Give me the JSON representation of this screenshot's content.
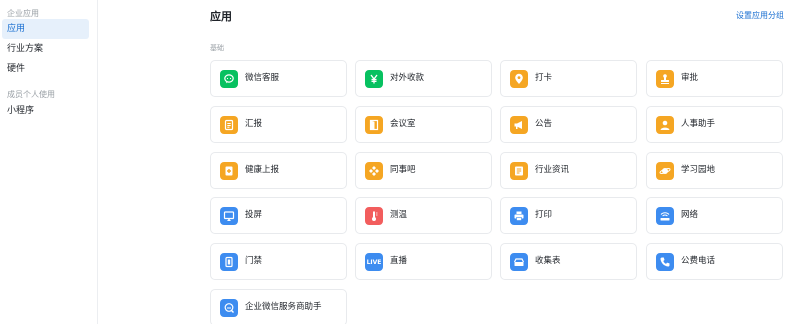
{
  "sidebar": {
    "group1": "企业应用",
    "group2": "成员个人使用",
    "items": [
      {
        "label": "应用",
        "active": true
      },
      {
        "label": "行业方案"
      },
      {
        "label": "硬件"
      },
      {
        "label": "小程序"
      }
    ]
  },
  "header": {
    "title": "应用",
    "settings_link": "设置应用分组"
  },
  "section": {
    "label": "基础"
  },
  "apps": [
    {
      "label": "微信客服",
      "icon": "wechat-chat-icon",
      "color": "#07c160"
    },
    {
      "label": "对外收款",
      "icon": "yuan-icon",
      "color": "#07c160"
    },
    {
      "label": "打卡",
      "icon": "location-pin-icon",
      "color": "#f5a623"
    },
    {
      "label": "审批",
      "icon": "stamp-icon",
      "color": "#f5a623"
    },
    {
      "label": "汇报",
      "icon": "report-icon",
      "color": "#f5a623"
    },
    {
      "label": "会议室",
      "icon": "door-icon",
      "color": "#f5a623"
    },
    {
      "label": "公告",
      "icon": "megaphone-icon",
      "color": "#f5a623"
    },
    {
      "label": "人事助手",
      "icon": "person-icon",
      "color": "#f5a623"
    },
    {
      "label": "健康上报",
      "icon": "health-icon",
      "color": "#f5a623"
    },
    {
      "label": "同事吧",
      "icon": "community-icon",
      "color": "#f5a623"
    },
    {
      "label": "行业资讯",
      "icon": "news-icon",
      "color": "#f5a623"
    },
    {
      "label": "学习园地",
      "icon": "planet-icon",
      "color": "#f5a623"
    },
    {
      "label": "投屏",
      "icon": "screen-cast-icon",
      "color": "#3d8cf0"
    },
    {
      "label": "测温",
      "icon": "thermometer-icon",
      "color": "#f25d5d"
    },
    {
      "label": "打印",
      "icon": "printer-icon",
      "color": "#3d8cf0"
    },
    {
      "label": "网络",
      "icon": "wifi-icon",
      "color": "#3d8cf0"
    },
    {
      "label": "门禁",
      "icon": "access-card-icon",
      "color": "#3d8cf0"
    },
    {
      "label": "直播",
      "icon": "live-icon",
      "color": "#3d8cf0",
      "badge": "LIVE"
    },
    {
      "label": "收集表",
      "icon": "form-icon",
      "color": "#3d8cf0"
    },
    {
      "label": "公费电话",
      "icon": "phone-icon",
      "color": "#3d8cf0"
    },
    {
      "label": "企业微信服务商助手",
      "icon": "service-assistant-icon",
      "color": "#3d8cf0"
    }
  ]
}
